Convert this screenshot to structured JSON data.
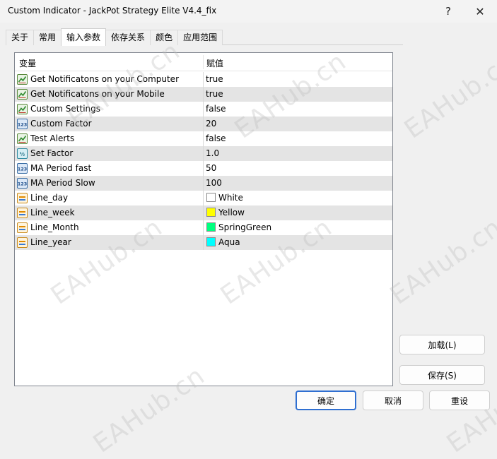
{
  "window": {
    "title": "Custom Indicator - JackPot Strategy Elite V4.4_fix",
    "help": "?",
    "close": "✕"
  },
  "tabs": [
    {
      "label": "关于"
    },
    {
      "label": "常用"
    },
    {
      "label": "输入参数",
      "active": true
    },
    {
      "label": "依存关系"
    },
    {
      "label": "颜色"
    },
    {
      "label": "应用范围"
    }
  ],
  "grid": {
    "headers": {
      "variable": "变量",
      "value": "赋值"
    },
    "rows": [
      {
        "name": "Get Notificatons on your Computer",
        "value": "true",
        "icon": "bool-icon"
      },
      {
        "name": "Get Notificatons on your Mobile",
        "value": "true",
        "icon": "bool-icon"
      },
      {
        "name": "Custom Settings",
        "value": "false",
        "icon": "bool-icon"
      },
      {
        "name": "Custom Factor",
        "value": "20",
        "icon": "int-icon"
      },
      {
        "name": "Test Alerts",
        "value": "false",
        "icon": "bool-icon"
      },
      {
        "name": "Set Factor",
        "value": "1.0",
        "icon": "double-icon"
      },
      {
        "name": "MA Period fast",
        "value": "50",
        "icon": "int-icon"
      },
      {
        "name": "MA Period Slow",
        "value": "100",
        "icon": "int-icon"
      },
      {
        "name": "Line_day",
        "value": "White",
        "icon": "color-icon",
        "color": "#ffffff"
      },
      {
        "name": "Line_week",
        "value": "Yellow",
        "icon": "color-icon",
        "color": "#ffff00"
      },
      {
        "name": "Line_Month",
        "value": "SpringGreen",
        "icon": "color-icon",
        "color": "#00ff7f"
      },
      {
        "name": "Line_year",
        "value": "Aqua",
        "icon": "color-icon",
        "color": "#00ffff"
      }
    ]
  },
  "buttons": {
    "load": "加载(L)",
    "save": "保存(S)",
    "ok": "确定",
    "cancel": "取消",
    "reset": "重设"
  },
  "watermark": "EAHub.cn",
  "colors": {
    "accent": "#2f6fd1",
    "alt_row": "#e4e4e4"
  }
}
